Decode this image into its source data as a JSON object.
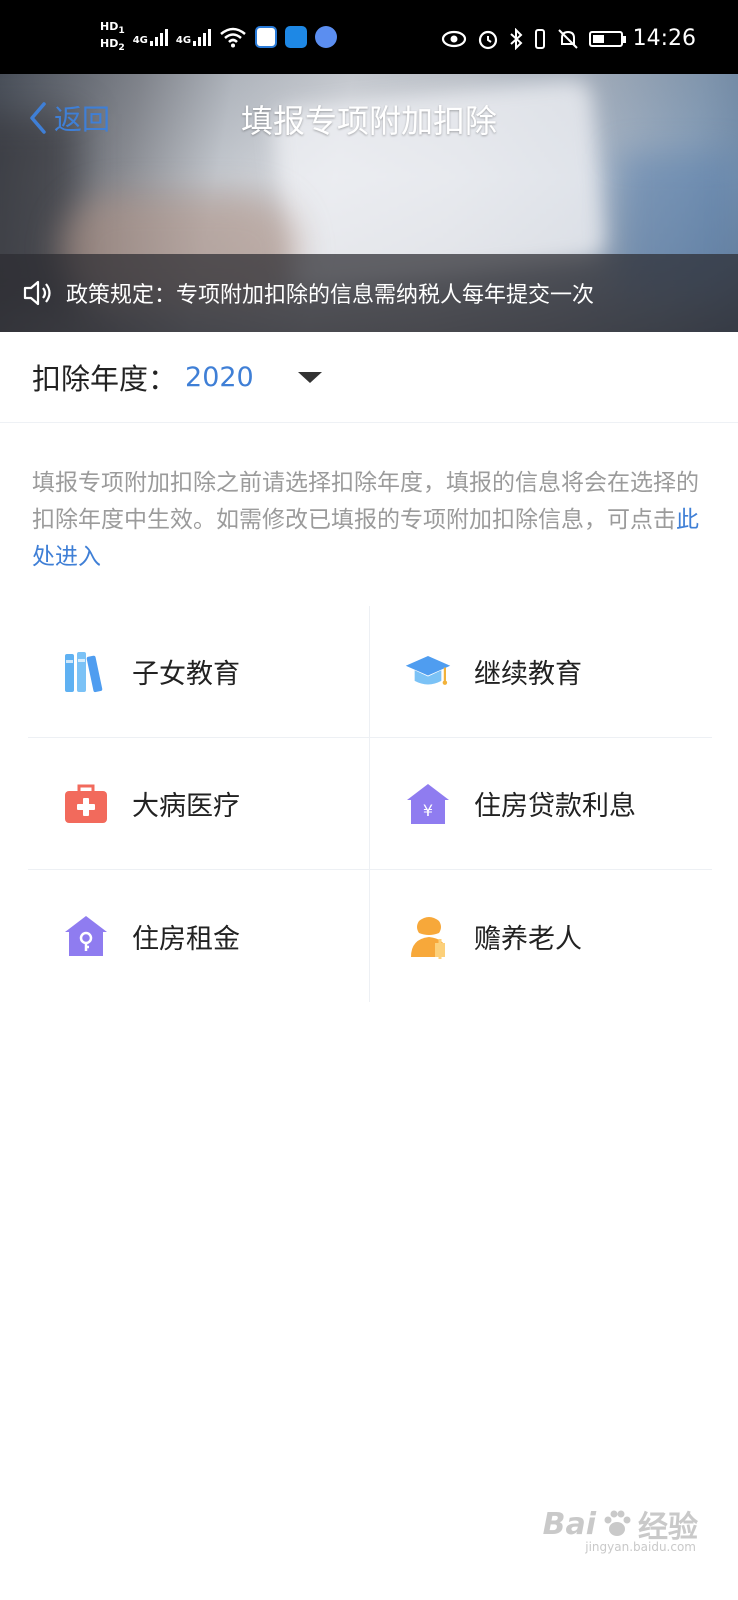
{
  "status_bar": {
    "sim1": "HD",
    "sim1_index": "1",
    "sim2": "HD",
    "sim2_index": "2",
    "net1": "4G",
    "net2": "4G",
    "time": "14:26",
    "battery_level": 0.45
  },
  "header": {
    "back_label": "返回",
    "title": "填报专项附加扣除",
    "notice": "政策规定：专项附加扣除的信息需纳税人每年提交一次"
  },
  "year_select": {
    "label": "扣除年度：",
    "value": "2020"
  },
  "tip": {
    "text": "填报专项附加扣除之前请选择扣除年度，填报的信息将会在选择的扣除年度中生效。如需修改已填报的专项附加扣除信息，可点击",
    "link": "此处进入"
  },
  "categories": [
    {
      "label": "子女教育",
      "icon": "books-icon",
      "color": "#5fb1f2"
    },
    {
      "label": "继续教育",
      "icon": "graduation-cap-icon",
      "color": "#4f9df0"
    },
    {
      "label": "大病医疗",
      "icon": "medical-kit-icon",
      "color": "#f26a5c"
    },
    {
      "label": "住房贷款利息",
      "icon": "house-yuan-icon",
      "color": "#8f7cf0"
    },
    {
      "label": "住房租金",
      "icon": "house-key-icon",
      "color": "#8f7cf0"
    },
    {
      "label": "赡养老人",
      "icon": "elderly-icon",
      "color": "#f7a83a"
    }
  ],
  "watermark": {
    "brand": "Bai",
    "brand_cn": "经验",
    "url": "jingyan.baidu.com"
  }
}
